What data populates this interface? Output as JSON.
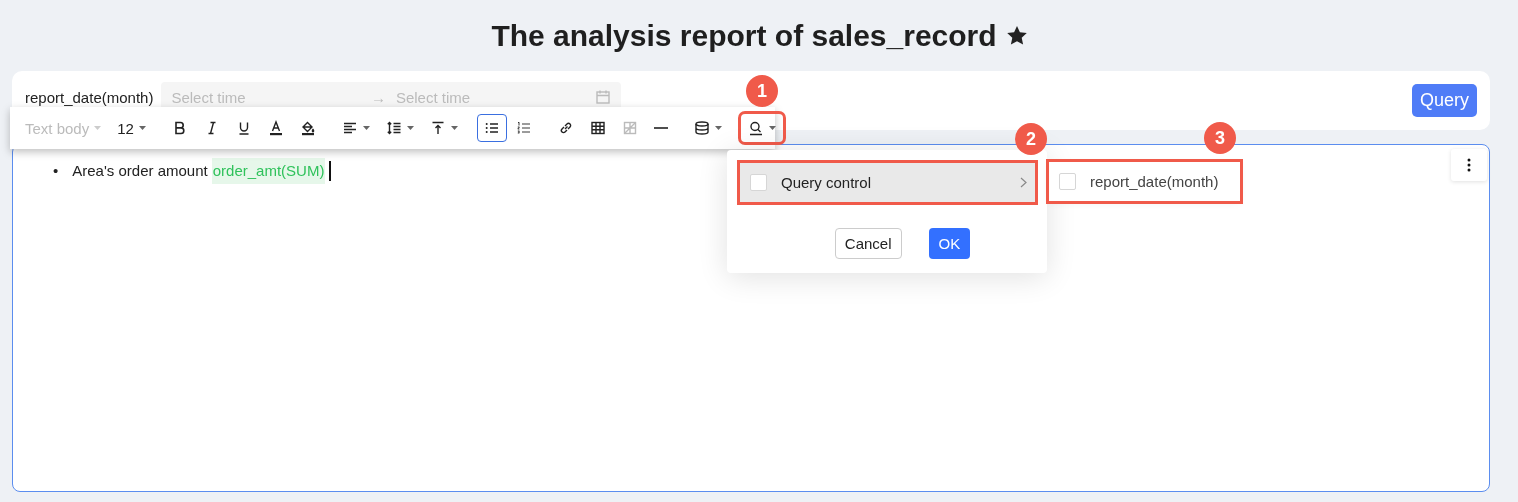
{
  "title": "The analysis report of sales_record",
  "starred": true,
  "filter": {
    "label": "report_date(month)",
    "start_placeholder": "Select time",
    "range_separator": "→",
    "end_placeholder": "Select time",
    "query_button": "Query"
  },
  "editor": {
    "bullets": [
      {
        "marker": "•",
        "text": "Area's order amount",
        "field": "order_amt(SUM)",
        "cursor": true
      }
    ]
  },
  "toolbar": [
    {
      "kind": "style-select",
      "label": "Text body",
      "disabled": true,
      "selected": false
    },
    {
      "kind": "size-select",
      "label": "12",
      "disabled": false,
      "selected": false
    },
    {
      "kind": "separator"
    },
    {
      "kind": "bold",
      "disabled": false,
      "selected": false
    },
    {
      "kind": "italic",
      "disabled": false,
      "selected": false
    },
    {
      "kind": "underline",
      "disabled": false,
      "selected": false
    },
    {
      "kind": "font-color",
      "disabled": false,
      "selected": false
    },
    {
      "kind": "fill-color",
      "disabled": false,
      "selected": false
    },
    {
      "kind": "separator"
    },
    {
      "kind": "align",
      "dropdown": true,
      "disabled": false,
      "selected": false
    },
    {
      "kind": "line-height",
      "dropdown": true,
      "disabled": false,
      "selected": false
    },
    {
      "kind": "vertical-align",
      "dropdown": true,
      "disabled": false,
      "selected": false
    },
    {
      "kind": "separator"
    },
    {
      "kind": "bullet-list",
      "disabled": false,
      "selected": true
    },
    {
      "kind": "ordered-list",
      "disabled": false,
      "selected": false
    },
    {
      "kind": "separator"
    },
    {
      "kind": "link",
      "disabled": false,
      "selected": false
    },
    {
      "kind": "table",
      "disabled": false,
      "selected": false
    },
    {
      "kind": "merge-cells",
      "disabled": true,
      "selected": false
    },
    {
      "kind": "divider",
      "disabled": false,
      "selected": false
    },
    {
      "kind": "separator"
    },
    {
      "kind": "database",
      "dropdown": true,
      "disabled": false,
      "selected": false
    },
    {
      "kind": "separator"
    },
    {
      "kind": "query",
      "dropdown": true,
      "disabled": false,
      "selected": false,
      "annotation": "1"
    }
  ],
  "menu": {
    "rows": [
      {
        "label": "Query control",
        "checked": false,
        "selected": true,
        "submenu": true,
        "annotation": "2"
      }
    ],
    "cancel_button": "Cancel",
    "ok_button": "OK"
  },
  "submenu": {
    "items": [
      {
        "label": "report_date(month)",
        "checked": false,
        "annotation": "3"
      }
    ]
  }
}
